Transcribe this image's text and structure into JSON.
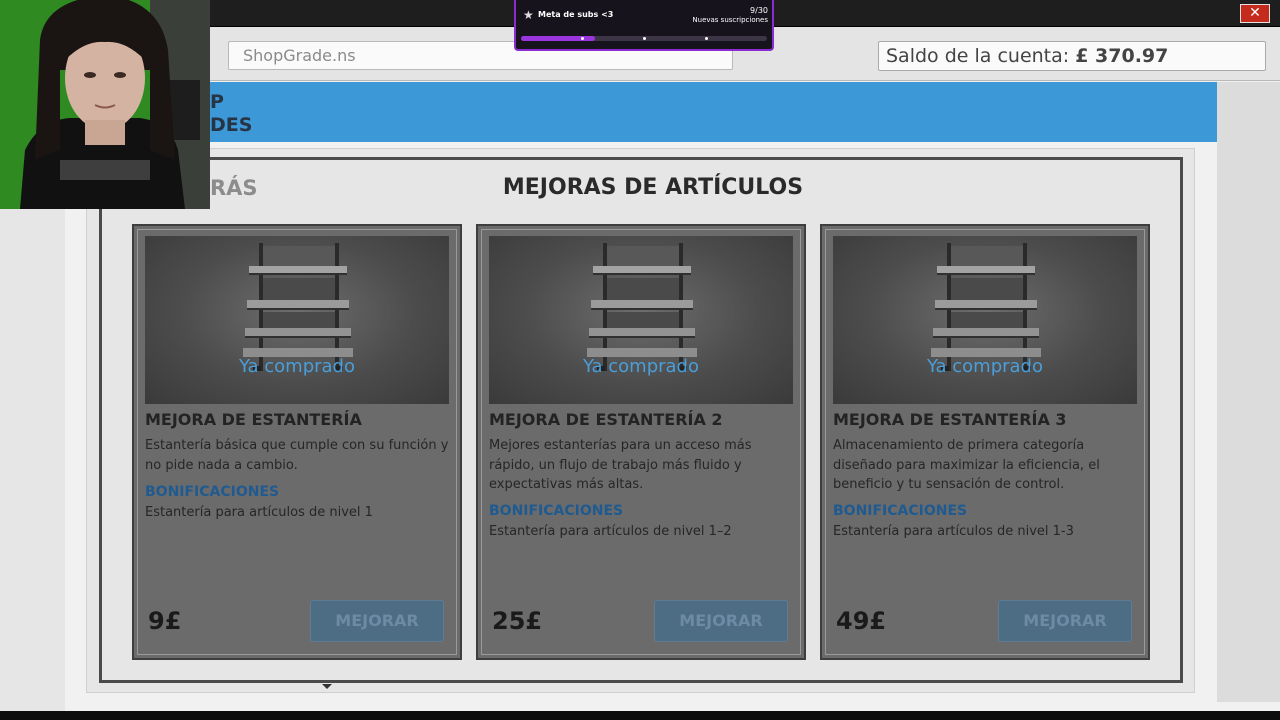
{
  "window": {
    "close_glyph": "✕"
  },
  "sub_goal": {
    "icon": "star-icon",
    "title": "Meta de subs <3",
    "count": "9/30",
    "label": "Nuevas suscripciones",
    "progress": 0.3
  },
  "address_bar": {
    "url": "ShopGrade.ns"
  },
  "balance": {
    "label": "Saldo de la cuenta:",
    "amount": "£ 370.97"
  },
  "header": {
    "logo_line1": "P",
    "logo_line2": "DES"
  },
  "modal": {
    "back_label": "RÁS",
    "title": "MEJORAS DE ARTÍCULOS",
    "cards": [
      {
        "purchased_label": "Ya comprado",
        "name": "MEJORA DE ESTANTERÍA",
        "description": "Estantería básica que cumple con su función y no pide nada a cambio.",
        "bonus_label": "BONIFICACIONES",
        "bonus": "Estantería para artículos de nivel 1",
        "price": "9£",
        "button": "MEJORAR"
      },
      {
        "purchased_label": "Ya comprado",
        "name": "MEJORA DE ESTANTERÍA 2",
        "description": "Mejores estanterías para un acceso más rápido, un flujo de trabajo más fluido y expectativas más altas.",
        "bonus_label": "BONIFICACIONES",
        "bonus": "Estantería para artículos de nivel 1–2",
        "price": "25£",
        "button": "MEJORAR"
      },
      {
        "purchased_label": "Ya comprado",
        "name": "MEJORA DE ESTANTERÍA 3",
        "description": "Almacenamiento de primera categoría diseñado para maximizar la eficiencia, el beneficio y tu sensación de control.",
        "bonus_label": "BONIFICACIONES",
        "bonus": "Estantería para artículos de nivel 1-3",
        "price": "49£",
        "button": "MEJORAR"
      }
    ]
  },
  "colors": {
    "header_blue": "#3d98d8",
    "purchased_text": "#4a9ed9",
    "bonus_label": "#1f5a90",
    "button_disabled": "#4d6d85",
    "sub_goal_accent": "#9b35e0",
    "close_red": "#c42b1c"
  }
}
